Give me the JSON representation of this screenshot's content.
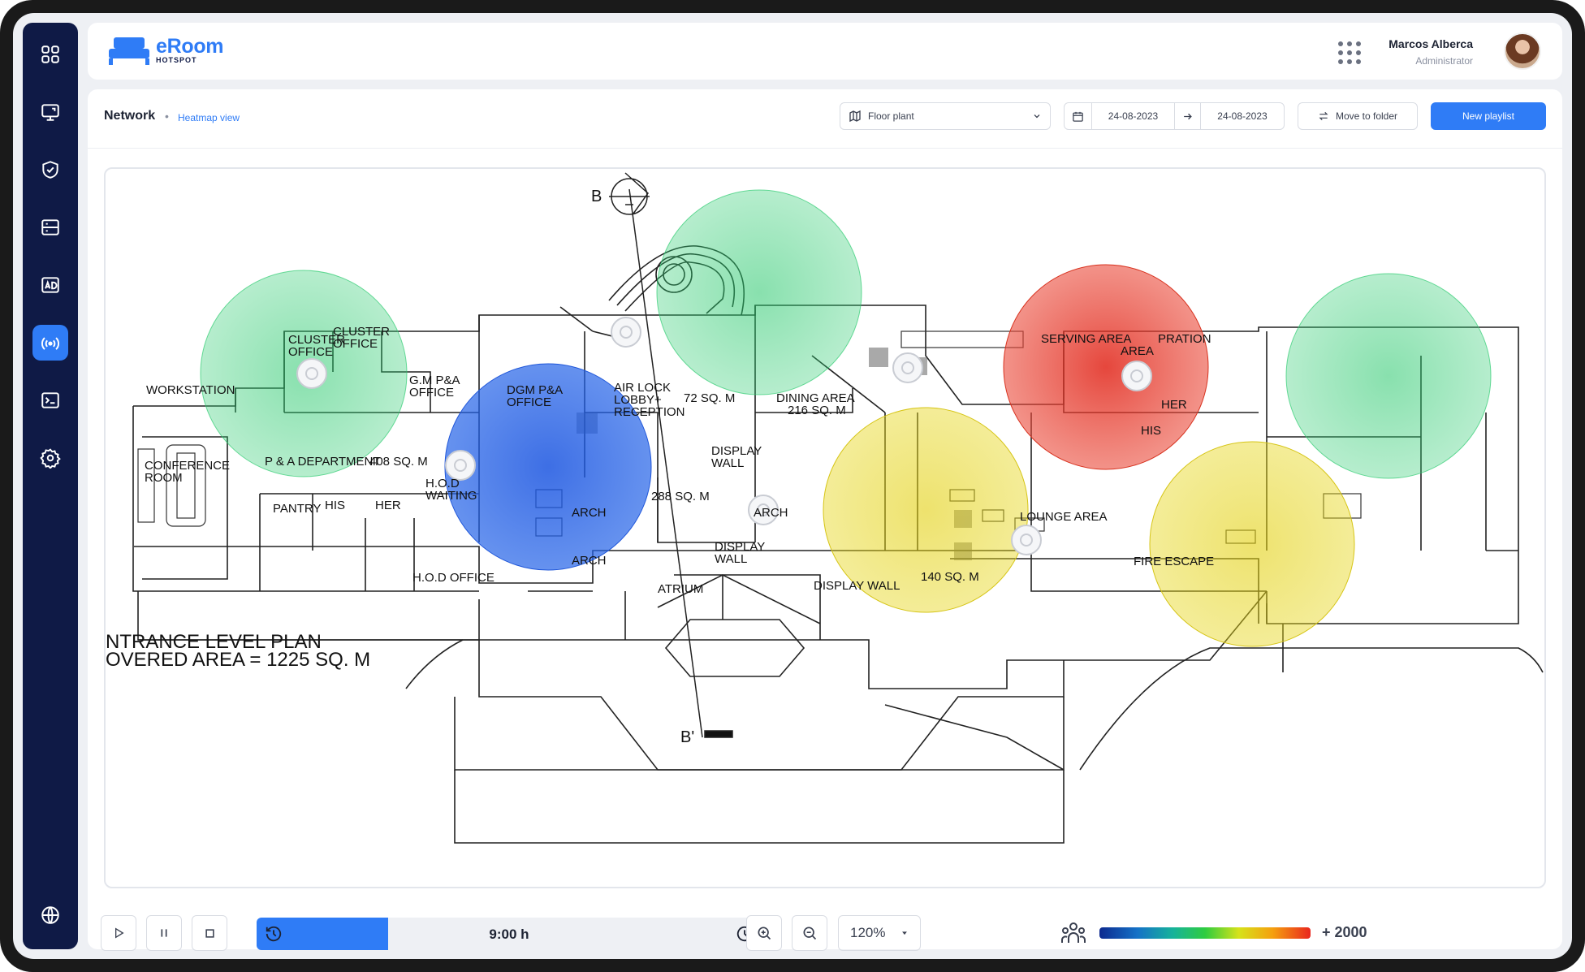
{
  "app": {
    "name": "eRoom",
    "subtitle": "HOTSPOT",
    "brand_color": "#2f7cf6",
    "sidebar_color": "#0f1a46"
  },
  "sidebar": {
    "items": [
      {
        "icon": "dashboard-grid-icon",
        "active": false
      },
      {
        "icon": "screen-cast-icon",
        "active": false
      },
      {
        "icon": "shield-check-icon",
        "active": false
      },
      {
        "icon": "server-icon",
        "active": false
      },
      {
        "icon": "ad-icon",
        "active": false
      },
      {
        "icon": "hotspot-signal-icon",
        "active": true
      },
      {
        "icon": "terminal-icon",
        "active": false
      },
      {
        "icon": "settings-gear-icon",
        "active": false
      }
    ],
    "bottom_icon": "globe-icon"
  },
  "header": {
    "user_name": "Marcos Alberca",
    "user_role": "Administrator"
  },
  "breadcrumb": {
    "title": "Network",
    "current": "Heatmap view"
  },
  "toolbar": {
    "floor_select": "Floor plant",
    "date_from": "24-08-2023",
    "date_to": "24-08-2023",
    "move_label": "Move to folder",
    "new_label": "New playlist"
  },
  "floorplan": {
    "labels": {
      "plan_title": "NTRANCE LEVEL PLAN",
      "plan_area": "OVERED AREA = 1225 SQ. M",
      "section_b": "B",
      "section_b2": "B'",
      "workstation": "WORKSTATION",
      "cluster_office_1": "CLUSTER",
      "cluster_office_1b": "OFFICE",
      "cluster_office_2": "CLUSTER",
      "cluster_office_2b": "OFFICE",
      "gm_office": "G.M P&A",
      "gm_office_b": "OFFICE",
      "dgm_office": "DGM P&A",
      "dgm_office_b": "OFFICE",
      "air_lock": "AIR LOCK",
      "lobby": "LOBBY+",
      "reception": "RECEPTION",
      "area_72": "72 SQ. M",
      "dining": "DINING AREA",
      "dining_area": "216 SQ. M",
      "serving": "SERVING AREA",
      "prep": "PRATION",
      "prep_b": "AREA",
      "her_1": "HER",
      "his_1": "HIS",
      "conference": "CONFERENCE",
      "conference_b": "ROOM",
      "pa_dept": "P & A DEPARTMENT",
      "pa_area": "408 SQ. M",
      "hod_waiting": "H.O.D",
      "hod_waiting_b": "WAITING",
      "pantry": "PANTRY",
      "his_2": "HIS",
      "her_2": "HER",
      "display_wall_1": "DISPLAY",
      "display_wall_1b": "WALL",
      "area_288": "288 SQ. M",
      "arch_1": "ARCH",
      "arch_2": "ARCH",
      "arch_3": "ARCH",
      "display_wall_2": "DISPLAY",
      "display_wall_2b": "WALL",
      "atrium": "ATRIUM",
      "display_wall_3": "DISPLAY WALL",
      "area_140": "140 SQ. M",
      "lounge": "LOUNGE AREA",
      "fire_escape": "FIRE ESCAPE",
      "hod_office": "H.O.D OFFICE"
    },
    "heat_zones": [
      {
        "name": "cluster-office-zone",
        "level": "low",
        "color": "#2ecc71"
      },
      {
        "name": "gm-office-zone",
        "level": "very-low",
        "color": "#2463e8"
      },
      {
        "name": "lobby-zone",
        "level": "low",
        "color": "#2ecc71"
      },
      {
        "name": "display-wall-zone",
        "level": "medium",
        "color": "#e6d61a"
      },
      {
        "name": "dining-zone",
        "level": "high",
        "color": "#e8392b"
      },
      {
        "name": "lounge-zone",
        "level": "medium",
        "color": "#e6d61a"
      },
      {
        "name": "serving-zone",
        "level": "low",
        "color": "#2ecc71"
      }
    ]
  },
  "playback": {
    "time": "9:00 h",
    "progress": 0.26
  },
  "zoom": {
    "value": "120%"
  },
  "legend": {
    "max_label": "+ 2000"
  }
}
